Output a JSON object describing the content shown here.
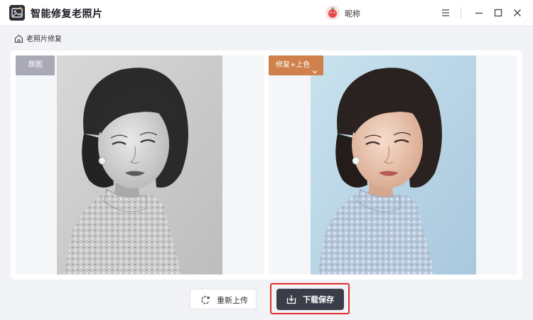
{
  "app": {
    "title": "智能修复老照片"
  },
  "user": {
    "nickname": "昵称"
  },
  "breadcrumb": {
    "label": "老照片修复"
  },
  "compare": {
    "original_label": "原图",
    "mode_label": "修复+上色"
  },
  "actions": {
    "reupload_label": "重新上传",
    "download_label": "下载保存"
  },
  "icons": {
    "menu": "menu-icon",
    "minimize": "minimize-icon",
    "maximize": "maximize-icon",
    "close": "close-icon",
    "home": "home-icon",
    "reupload": "refresh-icon",
    "download": "download-icon"
  },
  "colors": {
    "accent_orange": "#d0804b",
    "primary_dark": "#3b3d48",
    "highlight_red": "#e0302a",
    "original_tag_gray": "#a9aab5"
  }
}
